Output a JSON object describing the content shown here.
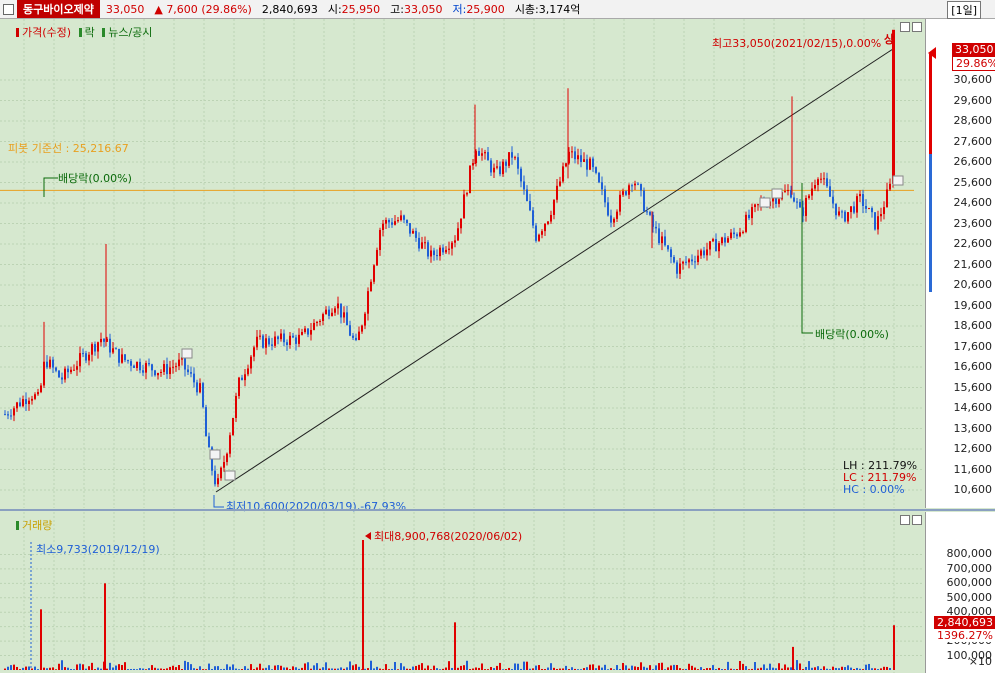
{
  "header": {
    "stock_name": "동구바이오제약",
    "price": "33,050",
    "change": "7,600",
    "change_pct": "(29.86%)",
    "volume": "2,840,693",
    "open_label": "시:",
    "open": "25,950",
    "high_label": "고:",
    "high": "33,050",
    "low_label": "저:",
    "low": "25,900",
    "mktcap_label": "시총:",
    "mktcap": "3,174억",
    "period": "[1일]"
  },
  "price_panel": {
    "legend_price": "가격(수정)",
    "legend_fall": "락",
    "legend_news": "뉴스/공시",
    "pivot_label": "피봇 기준선 : 25,216.67",
    "high_note": "최고33,050(2021/02/15),0.00%",
    "low_note": "최저10,600(2020/03/19),-67.93%",
    "dividend_note_1": "배당락(0.00%)",
    "dividend_note_2": "배당락(0.00%)",
    "limit_up_mark": "상",
    "news_mark": "뉴",
    "lh_label": "LH",
    "lh_value": ": 211.79%",
    "lc_label": "LC",
    "lc_value": ": 211.79%",
    "hc_label": "HC",
    "hc_value": ":   0.00%",
    "current_price_tag": "33,050",
    "current_pct_tag": "29.86%",
    "ticks": [
      "30,600",
      "29,600",
      "28,600",
      "27,600",
      "26,600",
      "25,600",
      "24,600",
      "23,600",
      "22,600",
      "21,600",
      "20,600",
      "19,600",
      "18,600",
      "17,600",
      "16,600",
      "15,600",
      "14,600",
      "13,600",
      "12,600",
      "11,600",
      "10,600"
    ]
  },
  "volume_panel": {
    "legend_volume": "거래량",
    "min_note": "최소9,733(2019/12/19)",
    "max_note": "최대8,900,768(2020/06/02)",
    "current_volume_tag": "2,840,693",
    "current_pct_tag": "1396.27%",
    "multiplier": "×10",
    "ticks": [
      "800,000",
      "700,000",
      "600,000",
      "500,000",
      "400,000",
      "300,000",
      "200,000",
      "100,000"
    ]
  },
  "colors": {
    "up": "#e00000",
    "down": "#1f5fd6",
    "pivot": "#e8a020",
    "background": "#d6e8cf",
    "grid": "#bcd3b4"
  }
}
